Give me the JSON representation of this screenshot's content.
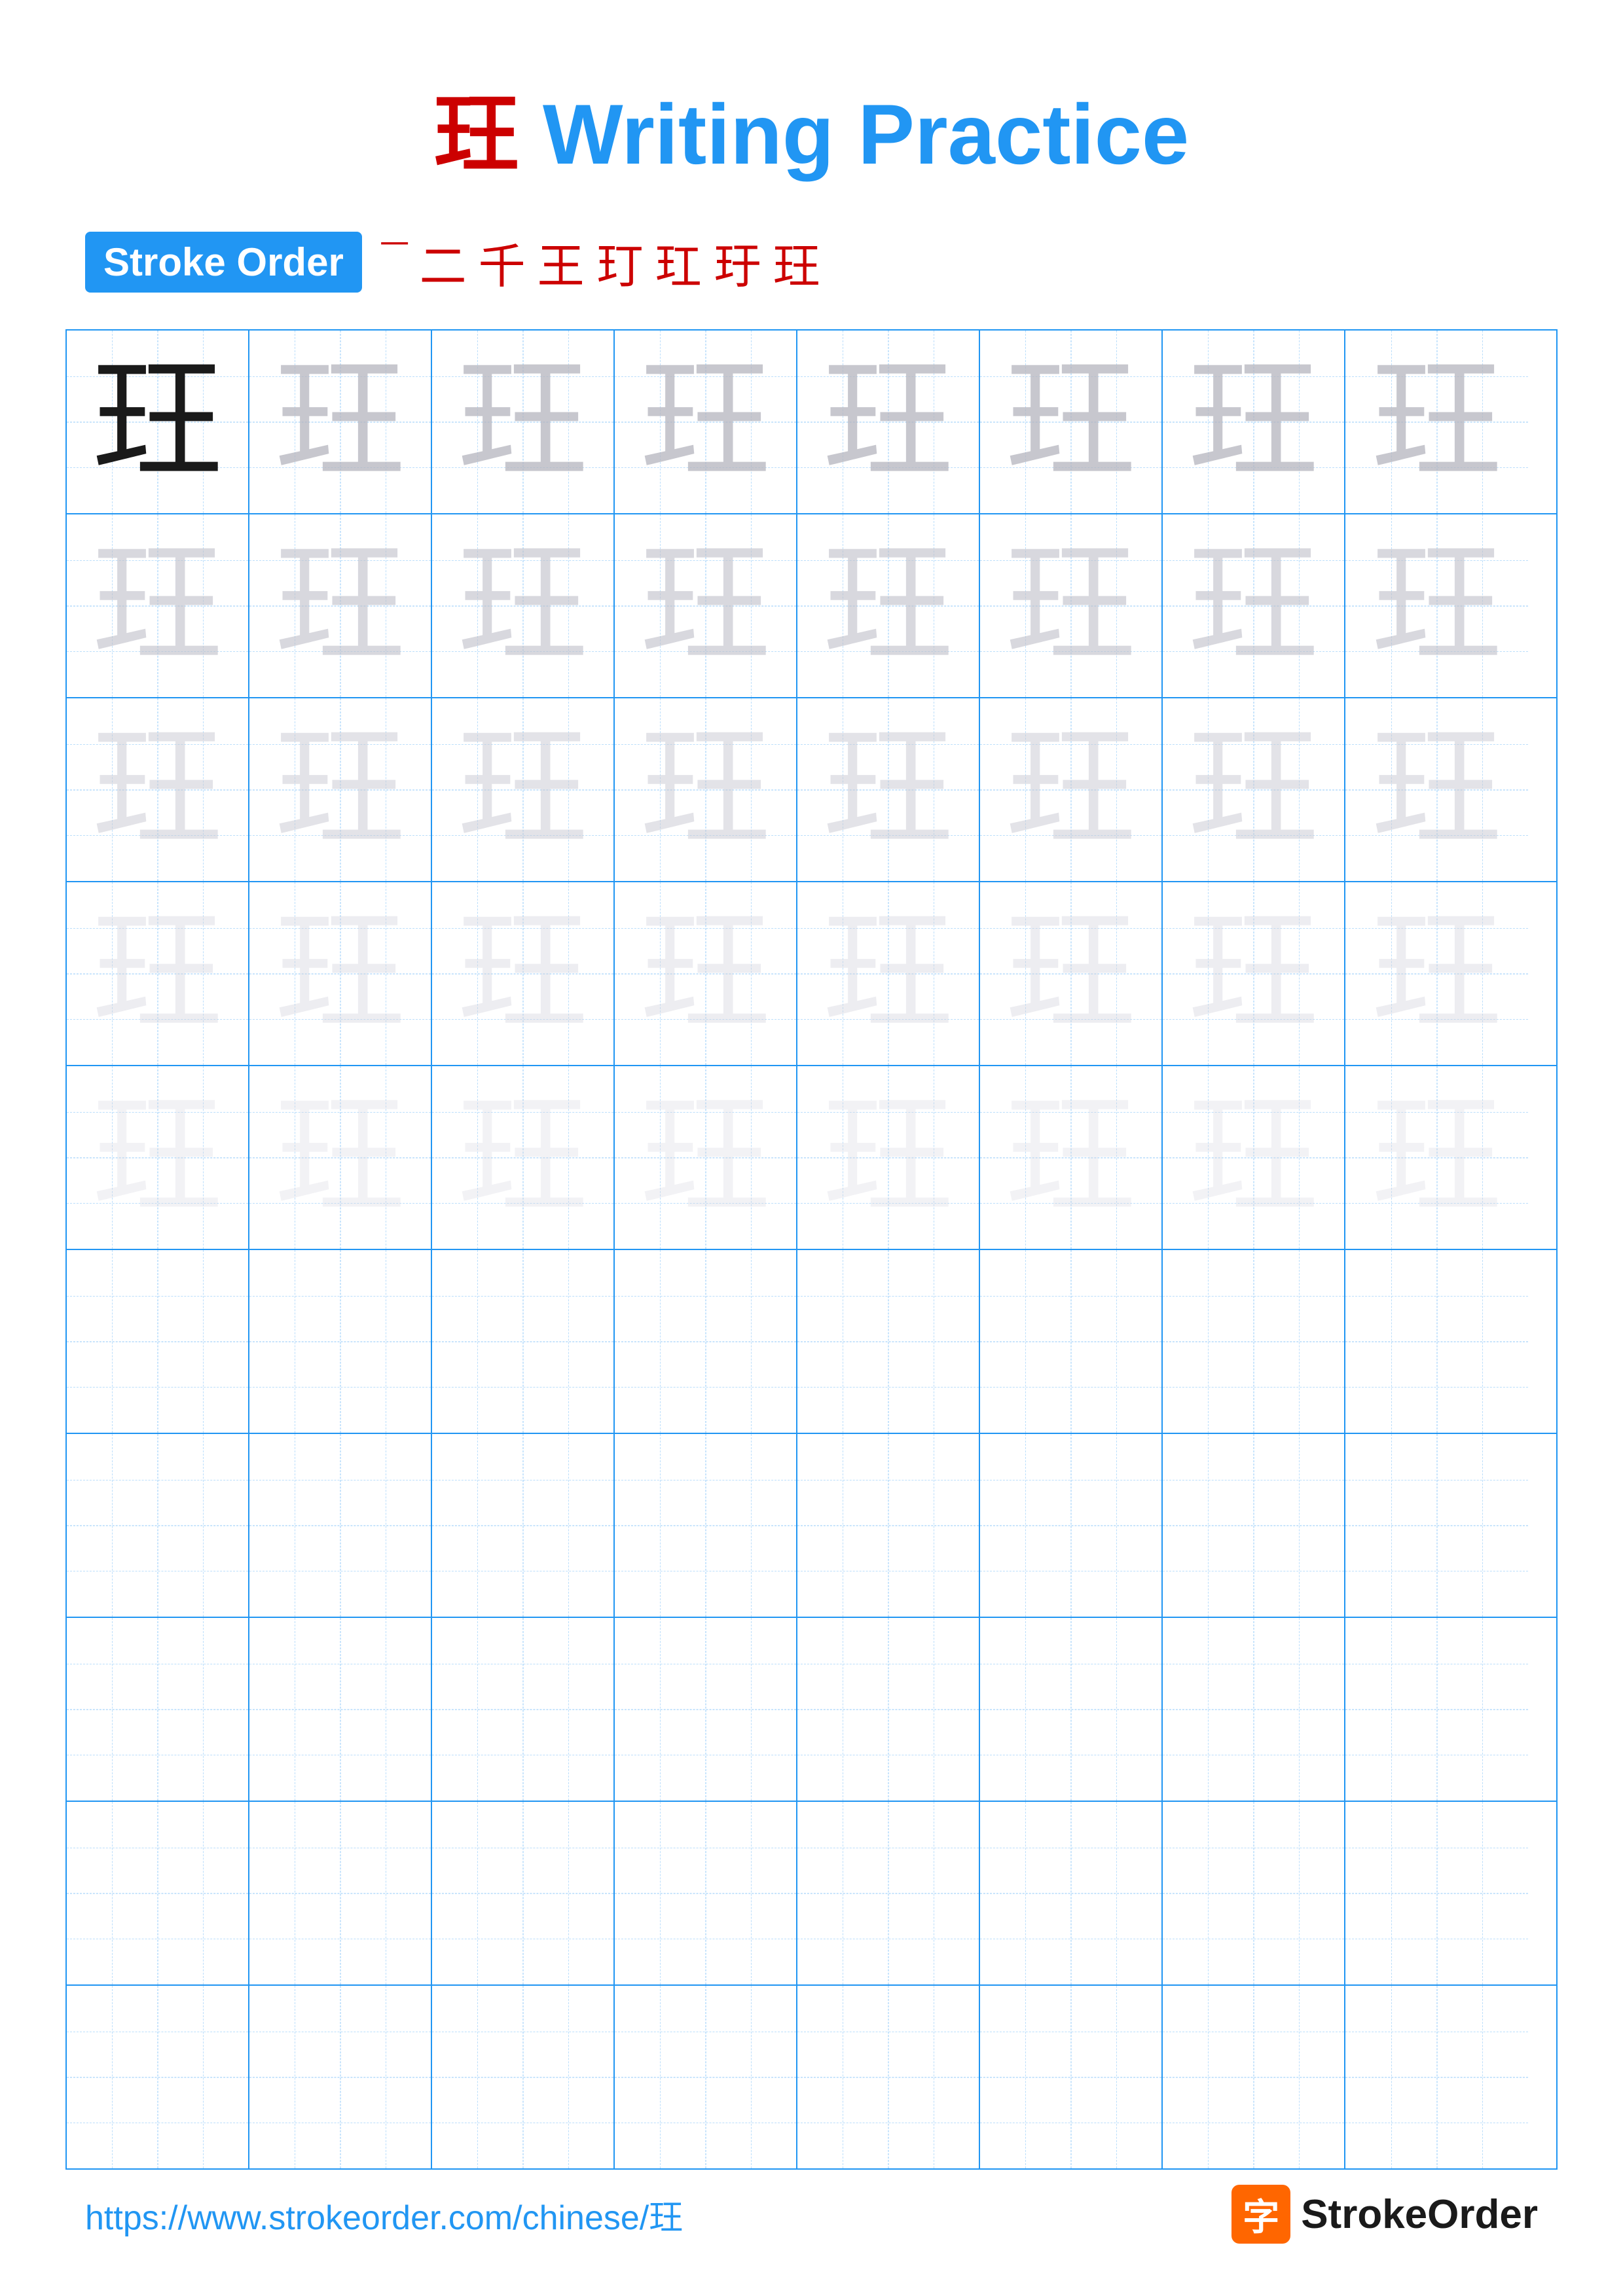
{
  "title": "玨 Writing Practice",
  "title_char": "玨",
  "title_text": " Writing Practice",
  "stroke_order_badge": "Stroke Order",
  "stroke_order_chars": [
    "¯",
    "二",
    "千",
    "王",
    "玎",
    "玒",
    "玗",
    "玨"
  ],
  "main_char": "玨",
  "grid": {
    "rows": 10,
    "cols": 8
  },
  "footer": {
    "url": "https://www.strokeorder.com/chinese/玨",
    "logo_icon": "字",
    "logo_text": "StrokeOrder"
  },
  "row_types": [
    "dark",
    "light1",
    "light2",
    "light3",
    "light4",
    "empty",
    "empty",
    "empty",
    "empty",
    "empty"
  ]
}
